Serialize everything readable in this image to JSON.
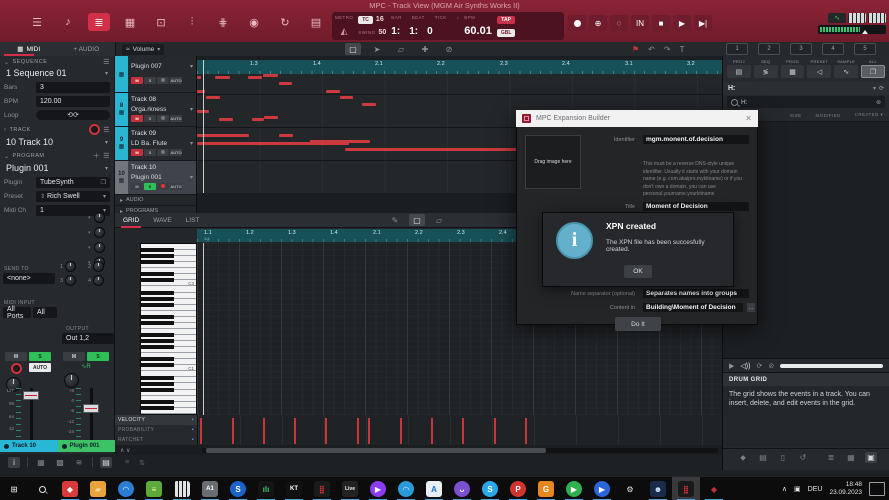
{
  "window": {
    "title": "MPC - Track View (MGM Air Synths Works II)"
  },
  "modes": {
    "items": [
      {
        "name": "menu",
        "glyph": "☰",
        "active": false
      },
      {
        "name": "main-mode",
        "glyph": "♪",
        "active": false
      },
      {
        "name": "track-view",
        "glyph": "≣",
        "active": true
      },
      {
        "name": "pad-perform",
        "glyph": "▦",
        "active": false
      },
      {
        "name": "sample-edit",
        "glyph": "⊡",
        "active": false
      },
      {
        "name": "program-edit",
        "glyph": "⫶",
        "active": false
      },
      {
        "name": "channel-mixer",
        "glyph": "⋕",
        "active": false
      },
      {
        "name": "sampler",
        "glyph": "◉",
        "active": false
      },
      {
        "name": "looper",
        "glyph": "↻",
        "active": false
      },
      {
        "name": "pad-mixer",
        "glyph": "▤",
        "active": false
      }
    ]
  },
  "transport": {
    "metro_label": "METRO",
    "tc_label": "TC",
    "tc_value": "16",
    "swing_label": "SWING",
    "swing_value": "50",
    "bar_label": "BAR",
    "beat_label": "BEAT",
    "tick_label": "TICK",
    "bar_value": "1:",
    "beat_value": "1:",
    "tick_value": "0",
    "bpm_label": "BPM",
    "bpm_value": "60.01",
    "tap_label": "TAP",
    "gbl_label": "GBL",
    "rec_buttons": [
      {
        "name": "record-button",
        "glyph": "dot"
      },
      {
        "name": "overdub-button",
        "glyph": "⊕"
      },
      {
        "name": "punch-button",
        "glyph": "◌"
      },
      {
        "name": "rec-in-button",
        "glyph": "IN"
      }
    ],
    "play_buttons": [
      {
        "name": "stop-button",
        "glyph": "■"
      },
      {
        "name": "play-button",
        "glyph": "▶"
      },
      {
        "name": "play-start-button",
        "glyph": "▶|"
      }
    ]
  },
  "subbar": {
    "midi_tab": "MIDI",
    "audio_tab": "+ AUDIO",
    "automation_value": "Volume",
    "tools": [
      {
        "name": "marquee-tool",
        "glyph": "▢",
        "active": true
      },
      {
        "name": "pointer-tool",
        "glyph": "➤",
        "active": false
      },
      {
        "name": "eraser-tool",
        "glyph": "▱",
        "active": false
      },
      {
        "name": "hand-tool",
        "glyph": "✚",
        "active": false
      },
      {
        "name": "mute-tool",
        "glyph": "⊘",
        "active": false
      }
    ],
    "marker_glyph": "⚑",
    "undo_glyph": "↶",
    "redo_glyph": "↷",
    "tee_glyph": "T",
    "locators": [
      "1",
      "2",
      "3",
      "4",
      "5"
    ]
  },
  "sidebar": {
    "sequence": {
      "header": "SEQUENCE",
      "value": "1 Sequence 01",
      "bars_label": "Bars",
      "bars": "3",
      "bpm_label": "BPM",
      "bpm": "120.00",
      "loop_label": "Loop"
    },
    "track": {
      "header": "TRACK",
      "value": "10 Track 10"
    },
    "program": {
      "header": "PROGRAM",
      "value": "Plugin 001",
      "plugin_label": "Plugin",
      "plugin": "TubeSynth",
      "preset_label": "Preset",
      "preset": "Rich Swell",
      "midich_label": "Midi Ch",
      "midich": "1"
    },
    "send_to_label": "SEND TO",
    "send_to": "<none>",
    "knob_numbers": [
      "1",
      "2",
      "3",
      "4"
    ],
    "midi_input_label": "MIDI INPUT",
    "midi_input_port": "All Ports",
    "midi_input_ch": "All",
    "output_label": "OUTPUT",
    "output": "Out 1,2",
    "mute_label": "M",
    "solo_label": "S",
    "auto_label": "AUTO",
    "fader_scale_left": [
      "127",
      "96",
      "64",
      "32",
      "0"
    ],
    "fader_scale_right": [
      "+6",
      "0",
      "-6",
      "-12",
      "-24",
      "-60"
    ],
    "channel_tabs": [
      {
        "label": "Track 10",
        "color": "#29b7d6"
      },
      {
        "label": "Plugin 001",
        "color": "#3ec267"
      }
    ],
    "bottom_icons": [
      {
        "name": "info-icon",
        "glyph": "i",
        "boxed": true
      },
      {
        "name": "sep"
      },
      {
        "name": "pad-grid-icon",
        "glyph": "▦"
      },
      {
        "name": "pad-bank-icon",
        "glyph": "▩"
      },
      {
        "name": "mixer-strip-icon",
        "glyph": "≋"
      },
      {
        "name": "sep"
      },
      {
        "name": "lanes-icon",
        "glyph": "▤",
        "boxed": true
      },
      {
        "name": "grid-icon",
        "glyph": "▦"
      },
      {
        "name": "sliders-icon",
        "glyph": "⇅"
      }
    ]
  },
  "track_list": {
    "tracks": [
      {
        "num": "7",
        "name": "",
        "program": "Plugin 007",
        "m": "red",
        "s": "off",
        "rec": "off",
        "strip": "cyan",
        "partial": true,
        "selected": false
      },
      {
        "num": "8",
        "name": "Track 08",
        "program": "Orga.rkness",
        "m": "red",
        "s": "off",
        "rec": "off",
        "strip": "cyan",
        "partial": false,
        "selected": false
      },
      {
        "num": "9",
        "name": "Track 09",
        "program": "LD Ba. Flute",
        "m": "red",
        "s": "off",
        "rec": "off",
        "strip": "cyan",
        "partial": false,
        "selected": false
      },
      {
        "num": "10",
        "name": "Track 10",
        "program": "Plugin 001",
        "m": "off",
        "s": "green",
        "rec": "on",
        "strip": "gray",
        "partial": false,
        "selected": true
      }
    ],
    "mute_label": "M",
    "solo_label": "S",
    "auto_label": "AUTO",
    "audio_section": "AUDIO",
    "programs_section": "PROGRAMS"
  },
  "timeline": {
    "ticks": [
      "1.3",
      "1.4",
      "2.1",
      "2.2",
      "2.3",
      "2.4",
      "3.1",
      "3.2"
    ],
    "tick_xs": [
      53,
      116,
      178,
      240,
      303,
      365,
      428,
      490
    ],
    "lane_ys": [
      20,
      53,
      86,
      119
    ],
    "notes": [
      [
        0,
        2,
        4
      ],
      [
        18,
        2,
        15
      ],
      [
        51,
        2,
        14
      ],
      [
        66,
        0,
        15
      ],
      [
        82,
        8,
        13
      ],
      [
        0,
        16,
        8
      ],
      [
        129,
        16,
        14
      ],
      [
        9,
        22,
        14
      ],
      [
        143,
        22,
        13
      ],
      [
        165,
        29,
        14
      ],
      [
        0,
        36,
        12
      ],
      [
        22,
        44,
        14
      ],
      [
        55,
        44,
        12
      ],
      [
        67,
        42,
        14
      ],
      [
        0,
        60,
        52
      ],
      [
        82,
        60,
        14
      ],
      [
        113,
        66,
        60
      ],
      [
        0,
        68,
        152
      ],
      [
        148,
        74,
        175
      ]
    ]
  },
  "grid": {
    "tabs": [
      {
        "label": "GRID",
        "active": true
      },
      {
        "label": "WAVE",
        "active": false
      },
      {
        "label": "LIST",
        "active": false
      }
    ],
    "tools": [
      {
        "name": "pencil-tool",
        "glyph": "✎",
        "active": false
      },
      {
        "name": "marquee-tool",
        "glyph": "▢",
        "active": true
      },
      {
        "name": "eraser-tool",
        "glyph": "▱",
        "active": false
      }
    ],
    "ruler_ticks": [
      "1.1",
      "1.2",
      "1.3",
      "1.4",
      "2.1",
      "2.2",
      "2.3",
      "2.4"
    ],
    "tick_xs": [
      7,
      49,
      91,
      133,
      176,
      218,
      260,
      302
    ],
    "time_sig": "4/4",
    "white_keys": 28,
    "key_labels": [
      {
        "index": 6,
        "label": "C3"
      },
      {
        "index": 20,
        "label": "C1"
      }
    ],
    "lanes": [
      "VELOCITY",
      "PROBABILITY",
      "RATCHET"
    ],
    "velocity_xs": [
      2,
      34,
      65,
      96,
      127,
      159,
      170,
      202,
      233,
      264,
      296,
      327
    ]
  },
  "browser": {
    "tabs": [
      {
        "label": "PROJ",
        "name": "tab-project",
        "glyph": "▤",
        "active": false
      },
      {
        "label": "SEQ",
        "name": "tab-sequence",
        "glyph": "≶",
        "active": false
      },
      {
        "label": "PROG",
        "name": "tab-program",
        "glyph": "▦",
        "active": false
      },
      {
        "label": "PRESET",
        "name": "tab-preset",
        "glyph": "◁",
        "active": false
      },
      {
        "label": "SAMPLE",
        "name": "tab-sample",
        "glyph": "∿",
        "active": false
      },
      {
        "label": "ALL",
        "name": "tab-all",
        "glyph": "❐",
        "active": true
      }
    ],
    "location": "H:",
    "search_value": "H:",
    "columns": [
      "SIZE",
      "MODIFIED",
      "CREATED ▾"
    ],
    "help_panel": {
      "title": "DRUM GRID",
      "text": "The grid shows the events in a track. You can insert, delete, and edit events in the grid."
    },
    "bottom_icons": [
      {
        "name": "tag-icon",
        "glyph": "⬥"
      },
      {
        "name": "file-icon",
        "glyph": "▤"
      },
      {
        "name": "trash-icon",
        "glyph": "▯"
      },
      {
        "name": "history-icon",
        "glyph": "↺"
      },
      {
        "name": "sep"
      },
      {
        "name": "list-icon",
        "glyph": "≣"
      },
      {
        "name": "keys-icon",
        "glyph": "▦"
      },
      {
        "name": "image-icon",
        "glyph": "▣",
        "boxed": true
      },
      {
        "name": "sep"
      },
      {
        "name": "help-icon",
        "glyph": "?",
        "boxedl": true
      }
    ]
  },
  "dialog": {
    "title": "MPC Expansion Builder",
    "drag_label": "Drag image here",
    "identifier_label": "Identifier",
    "identifier": "mgm.monent.of.decision",
    "identifier_help": "This must be a reverse DNS-style unique identifier. Usually it starts with your domain name (e.g. com.akaipro.mykitname) or if you don't own a domain, you can use personal.yourname.yourkitname",
    "title_label": "Title",
    "title_value": "Moment of Decision",
    "separator_label": "Name separator (optional)",
    "separator_value": "Separates names into groups",
    "content_label": "Content in",
    "content_value": "Building\\Moment of Decision",
    "dots_label": "...",
    "doit_label": "Do It",
    "popup": {
      "title": "XPN created",
      "message": "The XPN file has been succesfully created.",
      "ok_label": "OK"
    }
  },
  "taskbar": {
    "icons": [
      {
        "name": "start-button",
        "glyph": "⊞",
        "bg": "",
        "fg": "#dfe3e6",
        "active": false
      },
      {
        "name": "search-button",
        "glyph": "mag",
        "bg": "",
        "fg": "#dfe3e6",
        "active": false
      },
      {
        "name": "defender-app",
        "glyph": "◆",
        "bg": "#d93a3a",
        "fg": "#fff",
        "active": true
      },
      {
        "name": "file-explorer",
        "glyph": "▰",
        "bg": "#e8a33d",
        "fg": "#f7d9a3",
        "active": true
      },
      {
        "name": "edge-browser",
        "glyph": "◠",
        "bg": "#2b7cd3",
        "fg": "#bfe",
        "active": true,
        "round": true
      },
      {
        "name": "daw-green-app",
        "glyph": "≡",
        "bg": "#5cab3a",
        "fg": "#f3f7a9",
        "active": true
      },
      {
        "name": "piano-app",
        "glyph": "keys",
        "bg": "#dfe3e6",
        "fg": "#111",
        "active": true
      },
      {
        "name": "a1-app",
        "glyph": "A1",
        "bg": "#6a6e73",
        "fg": "#fff",
        "active": true
      },
      {
        "name": "s-swirl-app",
        "glyph": "S",
        "bg": "#1c64c9",
        "fg": "#fff",
        "active": true,
        "round": true
      },
      {
        "name": "analyzer-app",
        "glyph": "ılı",
        "bg": "#151515",
        "fg": "#3ec26b",
        "active": true
      },
      {
        "name": "kt-app",
        "glyph": "KT",
        "bg": "#111",
        "fg": "#fff",
        "active": true
      },
      {
        "name": "mpc-pads-app",
        "glyph": "⣿",
        "bg": "#1a1a1a",
        "fg": "#d2333b",
        "active": true
      },
      {
        "name": "live-app",
        "glyph": "Live",
        "bg": "#222",
        "fg": "#eee",
        "active": true
      },
      {
        "name": "player-app",
        "glyph": "▶",
        "bg": "#8a3df0",
        "fg": "#fff",
        "active": true,
        "round": true
      },
      {
        "name": "blue-swirl-app",
        "glyph": "◠",
        "bg": "#2a9ad8",
        "fg": "#def",
        "active": true,
        "round": true
      },
      {
        "name": "acrobat-app",
        "glyph": "A",
        "bg": "#e8eef5",
        "fg": "#1a73c9",
        "active": true
      },
      {
        "name": "purple-chat-app",
        "glyph": "ᴗ",
        "bg": "#7a4fd0",
        "fg": "#fff",
        "active": true,
        "round": true
      },
      {
        "name": "skype-app",
        "glyph": "S",
        "bg": "#28a8ea",
        "fg": "#fff",
        "active": true,
        "round": true
      },
      {
        "name": "pinterest-app",
        "glyph": "P",
        "bg": "#d0342c",
        "fg": "#fff",
        "active": true,
        "round": true
      },
      {
        "name": "g-app",
        "glyph": "G",
        "bg": "#e8871f",
        "fg": "#fff",
        "active": true
      },
      {
        "name": "green-play-app",
        "glyph": "▶",
        "bg": "#2faf4e",
        "fg": "#fff",
        "active": true,
        "round": true
      },
      {
        "name": "blue-play-app",
        "glyph": "▶",
        "bg": "#2a66d8",
        "fg": "#fff",
        "active": true,
        "round": true
      },
      {
        "name": "settings-app",
        "glyph": "⚙",
        "bg": "",
        "fg": "#dfe3e6",
        "active": false
      },
      {
        "name": "helmet-app",
        "glyph": "☻",
        "bg": "#1a2a4a",
        "fg": "#cfe3f5",
        "active": true
      },
      {
        "name": "mpc-grid-app",
        "glyph": "⣿",
        "bg": "#1a1a1a",
        "fg": "#d2333b",
        "active": true,
        "pressed": true
      },
      {
        "name": "red-audio-app",
        "glyph": "◆",
        "bg": "",
        "fg": "#c23038",
        "active": true
      }
    ],
    "tray": {
      "chevron": "∧",
      "lang": "DEU",
      "time": "18:48",
      "date": "23.09.2023"
    }
  }
}
